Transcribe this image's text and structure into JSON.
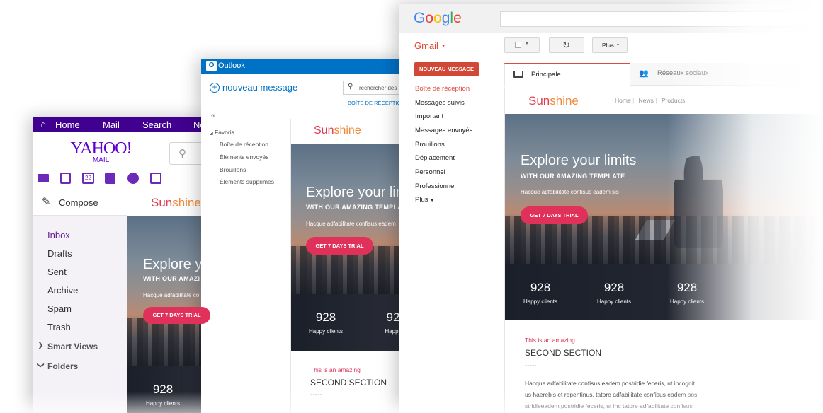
{
  "yahoo": {
    "top_nav": [
      "Home",
      "Mail",
      "Search",
      "Ne"
    ],
    "logo_line1": "YAHOO!",
    "logo_line2": "MAIL",
    "calendar_day": "22",
    "compose_label": "Compose",
    "folders": [
      "Inbox",
      "Drafts",
      "Sent",
      "Archive",
      "Spam",
      "Trash"
    ],
    "smart_views": "Smart Views",
    "folders_label": "Folders",
    "email": {
      "brand": "Sunshine",
      "hero_title": "Explore yo",
      "hero_sub": "WITH OUR AMAZI",
      "hero_text": "Hacque adfabilitate co",
      "cta": "GET 7 DAYS TRIAL",
      "stat_number": "928",
      "stat_label": "Happy clients"
    }
  },
  "outlook": {
    "app_name": "Outlook",
    "new_message": "nouveau message",
    "search_placeholder": "rechercher des",
    "inbox_tab": "BOÎTE DE RÉCEPTION",
    "collapse": "«",
    "favorites": "Favoris",
    "folders": [
      "Boîte de réception",
      "Éléments envoyés",
      "Brouillons",
      "Éléments supprimés"
    ],
    "email": {
      "brand": "Sunshine",
      "hero_title": "Explore your lim",
      "hero_sub": "WITH OUR AMAZING TEMPLAT",
      "hero_text": "Hacque adfabilitate confisus eadem",
      "cta": "GET 7 DAYS TRIAL",
      "stats": [
        {
          "number": "928",
          "label": "Happy clients"
        },
        {
          "number": "92",
          "label": "Happy"
        }
      ],
      "section_kicker": "This is an amazing",
      "section_title": "SECOND SECTION",
      "section_dashes": "-----"
    }
  },
  "gmail": {
    "logo": "Google",
    "app_label": "Gmail",
    "compose": "NOUVEAU MESSAGE",
    "more_button": "Plus",
    "tabs": [
      {
        "label": "Principale",
        "active": true
      },
      {
        "label": "Réseaux sociaux",
        "active": false
      }
    ],
    "labels": [
      "Boîte de réception",
      "Messages suivis",
      "Important",
      "Messages envoyés",
      "Brouillons",
      "Déplacement",
      "Personnel",
      "Professionnel"
    ],
    "more_labels": "Plus",
    "email": {
      "brand": "Sunshine",
      "nav": [
        "Home",
        "News",
        "Products"
      ],
      "hero_title": "Explore your limits",
      "hero_sub": "WITH OUR AMAZING TEMPLATE",
      "hero_text": "Hacque adfabilitate confisus eadem sis",
      "cta": "GET 7 DAYS TRIAL",
      "stats": [
        {
          "number": "928",
          "label": "Happy clients"
        },
        {
          "number": "928",
          "label": "Happy clients"
        },
        {
          "number": "928",
          "label": "Happy clients"
        }
      ],
      "section_kicker": "This is an amazing",
      "section_title": "SECOND SECTION",
      "section_dashes": "-----",
      "body_lines": [
        "Hacque adfabilitate confisus eadem postridie feceris, ut incognit",
        "us haerebis et repentinus, tatore adfabilitate confisus eadem pos",
        "stridieeadem postridie feceris, ut inc tatore adfabilitate confisus"
      ]
    }
  },
  "colors": {
    "yahoo_purple": "#400090",
    "outlook_blue": "#0072c6",
    "gmail_red": "#dd4b39",
    "cta_pink": "#e0315a",
    "stats_dark": "#1b1f2a"
  }
}
